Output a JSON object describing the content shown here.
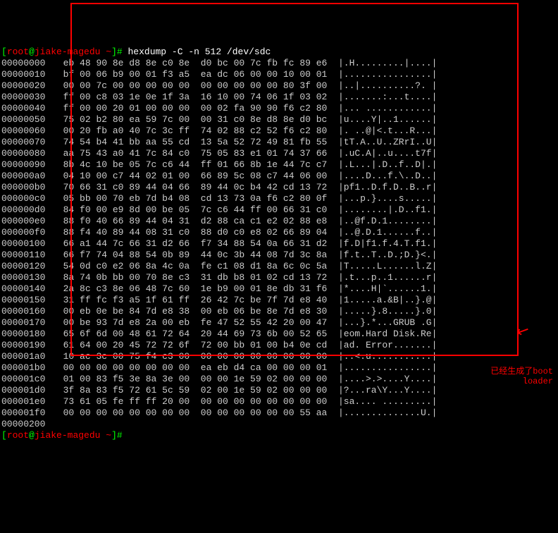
{
  "prompt": {
    "user": "root",
    "host": "jiake-magedu",
    "path": "~",
    "cmd": "hexdump -C -n 512 /dev/sdc"
  },
  "end_addr": "00000200",
  "annotation": {
    "line1": "已经生成了boot",
    "line2": "loader"
  },
  "rows": [
    {
      "a": "00000000",
      "h": [
        "eb",
        "48",
        "90",
        "8e",
        "d8",
        "8e",
        "c0",
        "8e",
        "d0",
        "bc",
        "00",
        "7c",
        "fb",
        "fc",
        "89",
        "e6"
      ],
      "s": ".H.........|...."
    },
    {
      "a": "00000010",
      "h": [
        "bf",
        "00",
        "06",
        "b9",
        "00",
        "01",
        "f3",
        "a5",
        "ea",
        "dc",
        "06",
        "00",
        "00",
        "10",
        "00",
        "01"
      ],
      "s": "................"
    },
    {
      "a": "00000020",
      "h": [
        "00",
        "00",
        "7c",
        "00",
        "00",
        "00",
        "00",
        "00",
        "00",
        "00",
        "00",
        "00",
        "00",
        "80",
        "3f",
        "00"
      ],
      "s": "..|..........?. "
    },
    {
      "a": "00000030",
      "h": [
        "ff",
        "00",
        "c8",
        "03",
        "1e",
        "0e",
        "1f",
        "3a",
        "16",
        "10",
        "00",
        "74",
        "06",
        "1f",
        "03",
        "02"
      ],
      "s": ".......:...t...."
    },
    {
      "a": "00000040",
      "h": [
        "ff",
        "00",
        "00",
        "20",
        "01",
        "00",
        "00",
        "00",
        "00",
        "02",
        "fa",
        "90",
        "90",
        "f6",
        "c2",
        "80"
      ],
      "s": "... ............"
    },
    {
      "a": "00000050",
      "h": [
        "75",
        "02",
        "b2",
        "80",
        "ea",
        "59",
        "7c",
        "00",
        "00",
        "31",
        "c0",
        "8e",
        "d8",
        "8e",
        "d0",
        "bc"
      ],
      "s": "u....Y|..1......"
    },
    {
      "a": "00000060",
      "h": [
        "00",
        "20",
        "fb",
        "a0",
        "40",
        "7c",
        "3c",
        "ff",
        "74",
        "02",
        "88",
        "c2",
        "52",
        "f6",
        "c2",
        "80"
      ],
      "s": ". ..@|<.t...R..."
    },
    {
      "a": "00000070",
      "h": [
        "74",
        "54",
        "b4",
        "41",
        "bb",
        "aa",
        "55",
        "cd",
        "13",
        "5a",
        "52",
        "72",
        "49",
        "81",
        "fb",
        "55"
      ],
      "s": "tT.A..U..ZRrI..U"
    },
    {
      "a": "00000080",
      "h": [
        "aa",
        "75",
        "43",
        "a0",
        "41",
        "7c",
        "84",
        "c0",
        "75",
        "05",
        "83",
        "e1",
        "01",
        "74",
        "37",
        "66"
      ],
      "s": ".uC.A|..u....t7f"
    },
    {
      "a": "00000090",
      "h": [
        "8b",
        "4c",
        "10",
        "be",
        "05",
        "7c",
        "c6",
        "44",
        "ff",
        "01",
        "66",
        "8b",
        "1e",
        "44",
        "7c",
        "c7"
      ],
      "s": ".L...|.D..f..D|."
    },
    {
      "a": "000000a0",
      "h": [
        "04",
        "10",
        "00",
        "c7",
        "44",
        "02",
        "01",
        "00",
        "66",
        "89",
        "5c",
        "08",
        "c7",
        "44",
        "06",
        "00"
      ],
      "s": "....D...f.\\..D.."
    },
    {
      "a": "000000b0",
      "h": [
        "70",
        "66",
        "31",
        "c0",
        "89",
        "44",
        "04",
        "66",
        "89",
        "44",
        "0c",
        "b4",
        "42",
        "cd",
        "13",
        "72"
      ],
      "s": "pf1..D.f.D..B..r"
    },
    {
      "a": "000000c0",
      "h": [
        "05",
        "bb",
        "00",
        "70",
        "eb",
        "7d",
        "b4",
        "08",
        "cd",
        "13",
        "73",
        "0a",
        "f6",
        "c2",
        "80",
        "0f"
      ],
      "s": "...p.}....s....."
    },
    {
      "a": "000000d0",
      "h": [
        "84",
        "f0",
        "00",
        "e9",
        "8d",
        "00",
        "be",
        "05",
        "7c",
        "c6",
        "44",
        "ff",
        "00",
        "66",
        "31",
        "c0"
      ],
      "s": "........|.D..f1."
    },
    {
      "a": "000000e0",
      "h": [
        "88",
        "f0",
        "40",
        "66",
        "89",
        "44",
        "04",
        "31",
        "d2",
        "88",
        "ca",
        "c1",
        "e2",
        "02",
        "88",
        "e8"
      ],
      "s": "..@f.D.1........"
    },
    {
      "a": "000000f0",
      "h": [
        "88",
        "f4",
        "40",
        "89",
        "44",
        "08",
        "31",
        "c0",
        "88",
        "d0",
        "c0",
        "e8",
        "02",
        "66",
        "89",
        "04"
      ],
      "s": "..@.D.1......f.."
    },
    {
      "a": "00000100",
      "h": [
        "66",
        "a1",
        "44",
        "7c",
        "66",
        "31",
        "d2",
        "66",
        "f7",
        "34",
        "88",
        "54",
        "0a",
        "66",
        "31",
        "d2"
      ],
      "s": "f.D|f1.f.4.T.f1."
    },
    {
      "a": "00000110",
      "h": [
        "66",
        "f7",
        "74",
        "04",
        "88",
        "54",
        "0b",
        "89",
        "44",
        "0c",
        "3b",
        "44",
        "08",
        "7d",
        "3c",
        "8a"
      ],
      "s": "f.t..T..D.;D.}<."
    },
    {
      "a": "00000120",
      "h": [
        "54",
        "0d",
        "c0",
        "e2",
        "06",
        "8a",
        "4c",
        "0a",
        "fe",
        "c1",
        "08",
        "d1",
        "8a",
        "6c",
        "0c",
        "5a"
      ],
      "s": "T.....L......l.Z"
    },
    {
      "a": "00000130",
      "h": [
        "8a",
        "74",
        "0b",
        "bb",
        "00",
        "70",
        "8e",
        "c3",
        "31",
        "db",
        "b8",
        "01",
        "02",
        "cd",
        "13",
        "72"
      ],
      "s": ".t...p..1......r"
    },
    {
      "a": "00000140",
      "h": [
        "2a",
        "8c",
        "c3",
        "8e",
        "06",
        "48",
        "7c",
        "60",
        "1e",
        "b9",
        "00",
        "01",
        "8e",
        "db",
        "31",
        "f6"
      ],
      "s": "*....H|`......1."
    },
    {
      "a": "00000150",
      "h": [
        "31",
        "ff",
        "fc",
        "f3",
        "a5",
        "1f",
        "61",
        "ff",
        "26",
        "42",
        "7c",
        "be",
        "7f",
        "7d",
        "e8",
        "40"
      ],
      "s": "1.....a.&B|..}.@"
    },
    {
      "a": "00000160",
      "h": [
        "00",
        "eb",
        "0e",
        "be",
        "84",
        "7d",
        "e8",
        "38",
        "00",
        "eb",
        "06",
        "be",
        "8e",
        "7d",
        "e8",
        "30"
      ],
      "s": ".....}.8.....}.0"
    },
    {
      "a": "00000170",
      "h": [
        "00",
        "be",
        "93",
        "7d",
        "e8",
        "2a",
        "00",
        "eb",
        "fe",
        "47",
        "52",
        "55",
        "42",
        "20",
        "00",
        "47"
      ],
      "s": "...}.*...GRUB .G"
    },
    {
      "a": "00000180",
      "h": [
        "65",
        "6f",
        "6d",
        "00",
        "48",
        "61",
        "72",
        "64",
        "20",
        "44",
        "69",
        "73",
        "6b",
        "00",
        "52",
        "65"
      ],
      "s": "eom.Hard Disk.Re"
    },
    {
      "a": "00000190",
      "h": [
        "61",
        "64",
        "00",
        "20",
        "45",
        "72",
        "72",
        "6f",
        "72",
        "00",
        "bb",
        "01",
        "00",
        "b4",
        "0e",
        "cd"
      ],
      "s": "ad. Error......."
    },
    {
      "a": "000001a0",
      "h": [
        "10",
        "ac",
        "3c",
        "00",
        "75",
        "f4",
        "c3",
        "00",
        "00",
        "00",
        "00",
        "00",
        "00",
        "00",
        "00",
        "00"
      ],
      "s": "..<.u..........."
    },
    {
      "a": "000001b0",
      "h": [
        "00",
        "00",
        "00",
        "00",
        "00",
        "00",
        "00",
        "00",
        "ea",
        "eb",
        "d4",
        "ca",
        "00",
        "00",
        "00",
        "01"
      ],
      "s": "................"
    },
    {
      "a": "000001c0",
      "h": [
        "01",
        "00",
        "83",
        "f5",
        "3e",
        "8a",
        "3e",
        "00",
        "00",
        "00",
        "1e",
        "59",
        "02",
        "00",
        "00",
        "00"
      ],
      "s": "....>.>....Y...."
    },
    {
      "a": "000001d0",
      "h": [
        "3f",
        "8a",
        "83",
        "f5",
        "72",
        "61",
        "5c",
        "59",
        "02",
        "00",
        "1e",
        "59",
        "02",
        "00",
        "00",
        "00"
      ],
      "s": "?...ra\\Y...Y...."
    },
    {
      "a": "000001e0",
      "h": [
        "73",
        "61",
        "05",
        "fe",
        "ff",
        "ff",
        "20",
        "00",
        "00",
        "00",
        "00",
        "00",
        "00",
        "00",
        "00",
        "00"
      ],
      "s": "sa.... ........."
    },
    {
      "a": "000001f0",
      "h": [
        "00",
        "00",
        "00",
        "00",
        "00",
        "00",
        "00",
        "00",
        "00",
        "00",
        "00",
        "00",
        "00",
        "00",
        "55",
        "aa"
      ],
      "s": "..............U."
    }
  ]
}
